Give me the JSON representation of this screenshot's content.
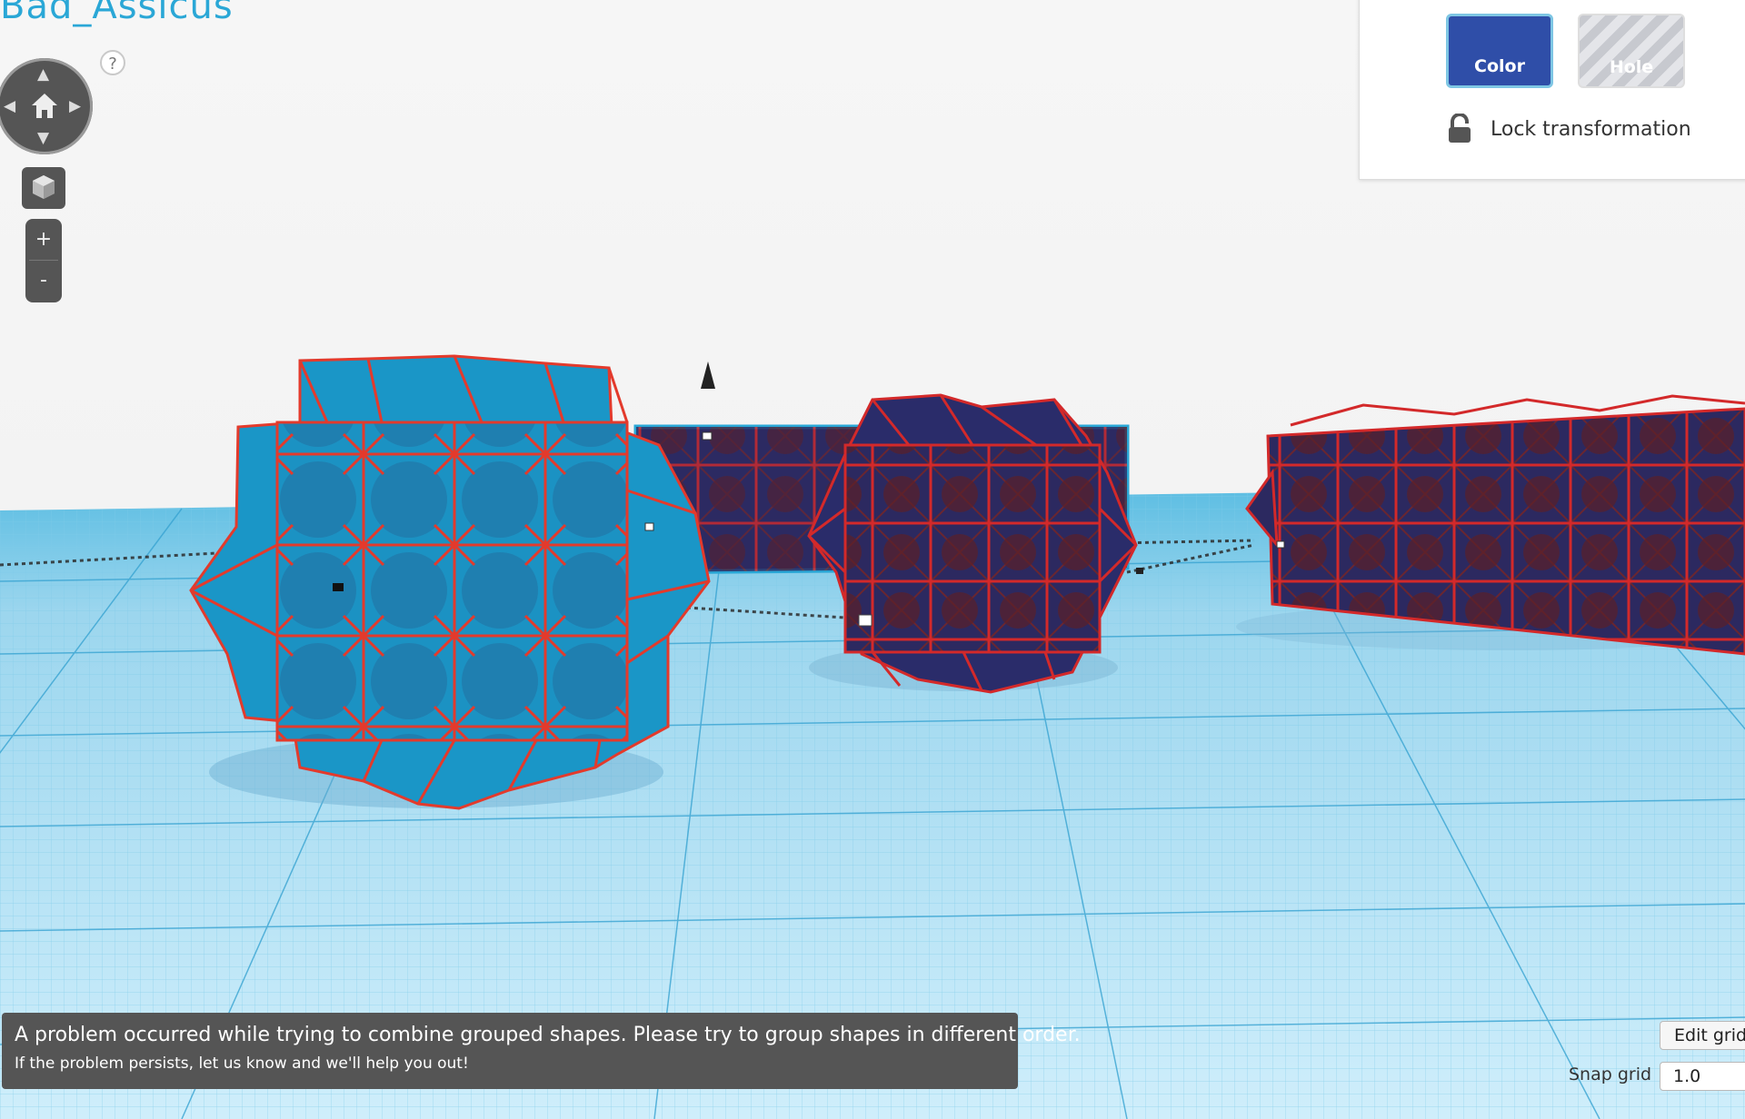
{
  "project": {
    "title": "Bad_Assicus"
  },
  "viewport_nav": {
    "help_label": "?",
    "zoom_in_label": "+",
    "zoom_out_label": "-"
  },
  "inspector": {
    "color_label": "Color",
    "hole_label": "Hole",
    "lock_label": "Lock transformation"
  },
  "notification": {
    "message": "A problem occurred while trying to combine grouped shapes. Please try to group shapes in different order.",
    "submessage": "If the problem persists, let us know and we'll help you out!"
  },
  "grid_controls": {
    "edit_grid_label": "Edit grid",
    "snap_grid_label": "Snap grid",
    "snap_grid_value": "1.0"
  },
  "colors": {
    "brand": "#2aa7d6",
    "color_swatch": "#2f4ea8",
    "edge_highlight": "#e8322a",
    "workplane_line": "#3aa6d4",
    "selected_shape": "#1996c8",
    "dark_shape": "#35307a"
  },
  "icons": [
    "help-icon",
    "arrow-up-icon",
    "arrow-down-icon",
    "arrow-left-icon",
    "arrow-right-icon",
    "home-icon",
    "cube-icon",
    "lock-icon"
  ]
}
